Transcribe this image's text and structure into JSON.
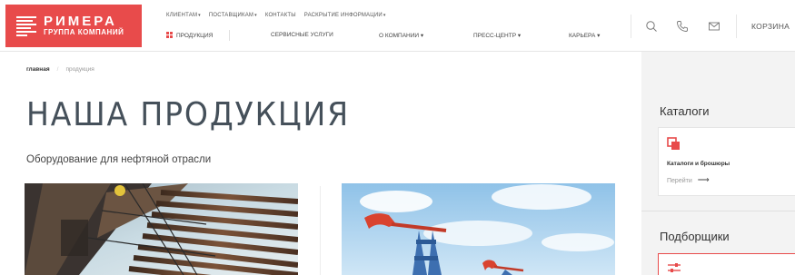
{
  "logo": {
    "name": "РИМЕРА",
    "subtitle": "ГРУППА КОМПАНИЙ"
  },
  "top_nav": [
    {
      "label": "КЛИЕНТАМ",
      "has_dropdown": true
    },
    {
      "label": "ПОСТАВЩИКАМ",
      "has_dropdown": true
    },
    {
      "label": "КОНТАКТЫ",
      "has_dropdown": false
    },
    {
      "label": "РАСКРЫТИЕ ИНФОРМАЦИИ",
      "has_dropdown": true
    }
  ],
  "main_nav": {
    "products": "ПРОДУКЦИЯ",
    "services": "СЕРВИСНЫЕ УСЛУГИ",
    "company": "О КОМПАНИИ",
    "press": "ПРЕСС-ЦЕНТР",
    "career": "КАРЬЕРА"
  },
  "header_icons": [
    "search-icon",
    "phone-icon",
    "mail-icon"
  ],
  "cart": "КОРЗИНА",
  "breadcrumb": {
    "home": "главная",
    "separator": "/",
    "current": "продукция"
  },
  "page_title": "НАША ПРОДУКЦИЯ",
  "section_title": "Оборудование для нефтяной отрасли",
  "sidebar": {
    "catalogs_title": "Каталоги",
    "catalog_card": {
      "title": "Каталоги и брошюры",
      "link": "Перейти",
      "icon": "documents-icon"
    },
    "selectors_title": "Подборщики",
    "selector_icon": "sliders-icon"
  },
  "colors": {
    "brand_red": "#e84b4b",
    "title": "#45505a",
    "sidebar_bg": "#f3f3f3"
  }
}
